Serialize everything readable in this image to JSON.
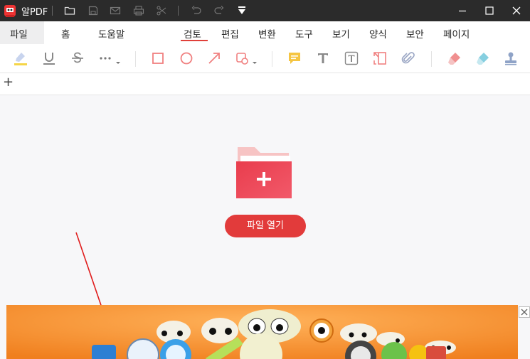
{
  "app": {
    "title": "알PDF"
  },
  "menubar": {
    "items": [
      "파일",
      "홈",
      "도움말",
      "검토",
      "편집",
      "변환",
      "도구",
      "보기",
      "양식",
      "보안",
      "페이지"
    ],
    "active": "검토"
  },
  "tabstrip": {
    "add_label": "+"
  },
  "main": {
    "open_button_label": "파일 열기"
  },
  "colors": {
    "accent": "#e23b3b",
    "titlebar": "#2b2b2b",
    "folder": "#ef4f5e",
    "ad_bg": "#f6902d"
  },
  "icons": {
    "titlebar": [
      "folder-icon",
      "save-icon",
      "mail-icon",
      "print-icon",
      "scissors-icon",
      "undo-icon",
      "redo-icon",
      "dropdown-icon"
    ],
    "toolbar": [
      "highlighter-icon",
      "underline-icon",
      "strikethrough-icon",
      "more-icon",
      "rectangle-icon",
      "circle-icon",
      "arrow-icon",
      "shape-icon",
      "note-icon",
      "text-icon",
      "textbox-icon",
      "callout-icon",
      "attachment-icon",
      "eraser-icon",
      "clear-icon",
      "stamp-icon"
    ]
  }
}
